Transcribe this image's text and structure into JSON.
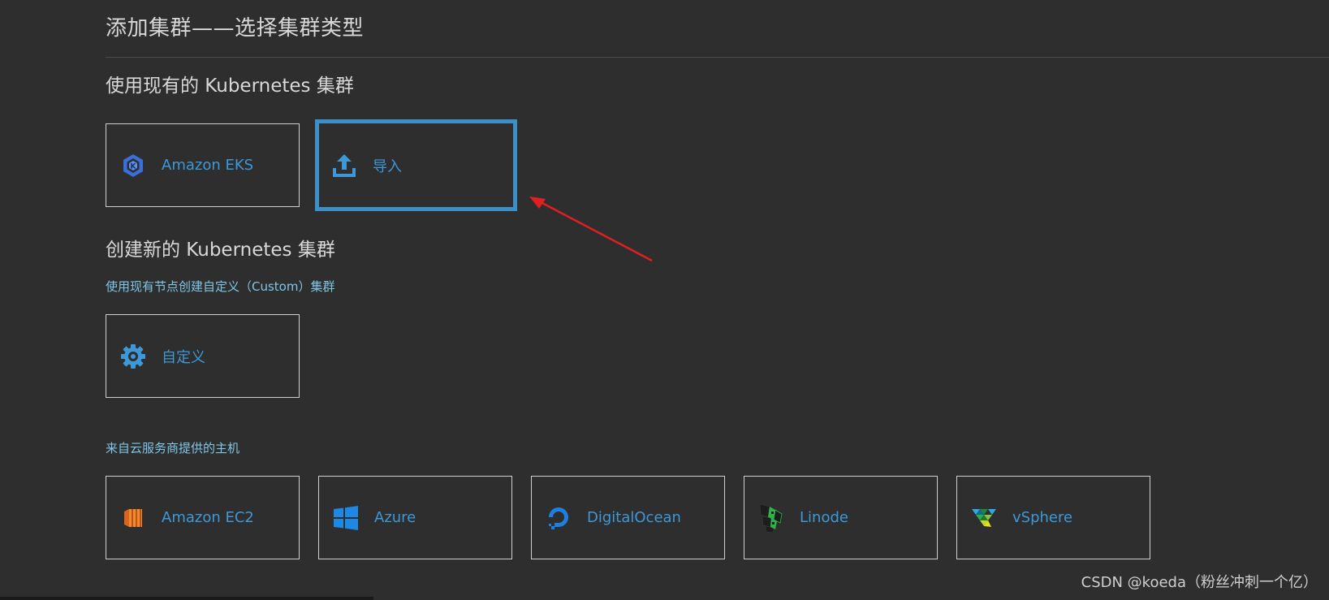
{
  "header": {
    "title": "添加集群——选择集群类型"
  },
  "existing_section": {
    "heading": "使用现有的 Kubernetes 集群",
    "cards": [
      {
        "label": "Amazon EKS",
        "icon": "amazon-eks-icon"
      },
      {
        "label": "导入",
        "icon": "upload-icon",
        "selected": true
      }
    ]
  },
  "create_section": {
    "heading": "创建新的 Kubernetes 集群",
    "custom_subtitle": "使用现有节点创建自定义（Custom）集群",
    "custom_card": {
      "label": "自定义",
      "icon": "gear-icon"
    },
    "cloud_subtitle": "来自云服务商提供的主机",
    "cloud_cards": [
      {
        "label": "Amazon EC2",
        "icon": "amazon-ec2-icon"
      },
      {
        "label": "Azure",
        "icon": "windows-icon"
      },
      {
        "label": "DigitalOcean",
        "icon": "digitalocean-icon"
      },
      {
        "label": "Linode",
        "icon": "linode-icon"
      },
      {
        "label": "vSphere",
        "icon": "vsphere-icon"
      }
    ]
  },
  "watermark": "CSDN @koeda（粉丝冲刺一个亿）",
  "colors": {
    "background": "#2e2e2e",
    "accent": "#3d98d8",
    "selected_border": "#3d8fc7",
    "subtitle": "#7fc6e6",
    "arrow": "#e02020"
  }
}
